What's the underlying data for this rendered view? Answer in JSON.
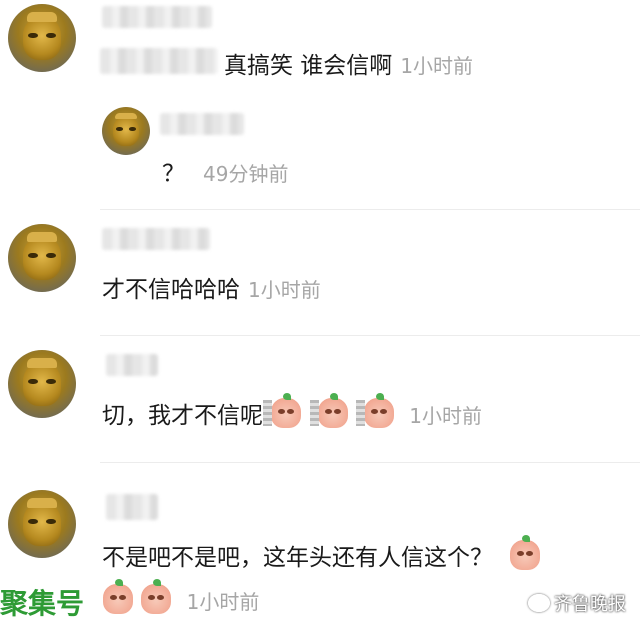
{
  "comments": [
    {
      "text": "真搞笑 谁会信啊",
      "time": "1小时前"
    },
    {
      "reply": true,
      "text": "？",
      "time": "49分钟前"
    },
    {
      "text": "才不信哈哈哈",
      "time": "1小时前"
    },
    {
      "text": "切，我才不信呢",
      "time": "1小时前",
      "emoji_count": 3
    },
    {
      "text": "不是吧不是吧，这年头还有人信这个？",
      "time": "1小时前",
      "emoji_count": 3
    }
  ],
  "watermarks": {
    "left": "聚集号",
    "right": "齐鲁晚报"
  },
  "colors": {
    "watermark_left": "#2e9b35",
    "timestamp": "#a6a6a6"
  }
}
